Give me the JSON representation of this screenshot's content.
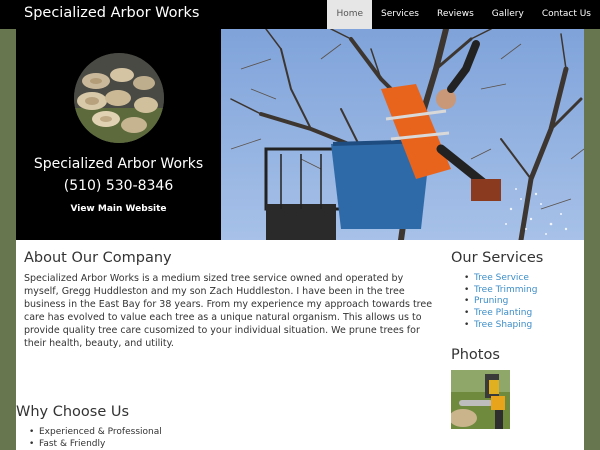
{
  "header": {
    "brand": "Specialized Arbor Works",
    "nav": [
      {
        "label": "Home",
        "active": true
      },
      {
        "label": "Services",
        "active": false
      },
      {
        "label": "Reviews",
        "active": false
      },
      {
        "label": "Gallery",
        "active": false
      },
      {
        "label": "Contact Us",
        "active": false
      }
    ]
  },
  "hero": {
    "name": "Specialized Arbor Works",
    "phone": "(510) 530-8346",
    "link": "View Main Website"
  },
  "about": {
    "title": "About Our Company",
    "text": "Specialized Arbor Works is a medium sized tree service owned and operated by myself, Gregg Huddleston and my son Zach Huddleston.  I have been in the tree business in the East Bay for 38 years.  From my experience my approach towards tree care has evolved to value each tree as a unique natural organism.  This allows us to provide quality tree care cusomized to your individual situation. We prune trees for their health, beauty, and utility."
  },
  "why": {
    "title": "Why Choose Us",
    "items": [
      "Experienced & Professional",
      "Fast & Friendly"
    ]
  },
  "services": {
    "title": "Our Services",
    "items": [
      "Tree Service",
      "Tree Trimming",
      "Pruning",
      "Tree Planting",
      "Tree Shaping"
    ]
  },
  "photos": {
    "title": "Photos"
  },
  "colors": {
    "page_background": "#687650",
    "topbar": "#000000",
    "nav_active_bg": "#e6e6e6",
    "link": "#3d8ec9"
  }
}
